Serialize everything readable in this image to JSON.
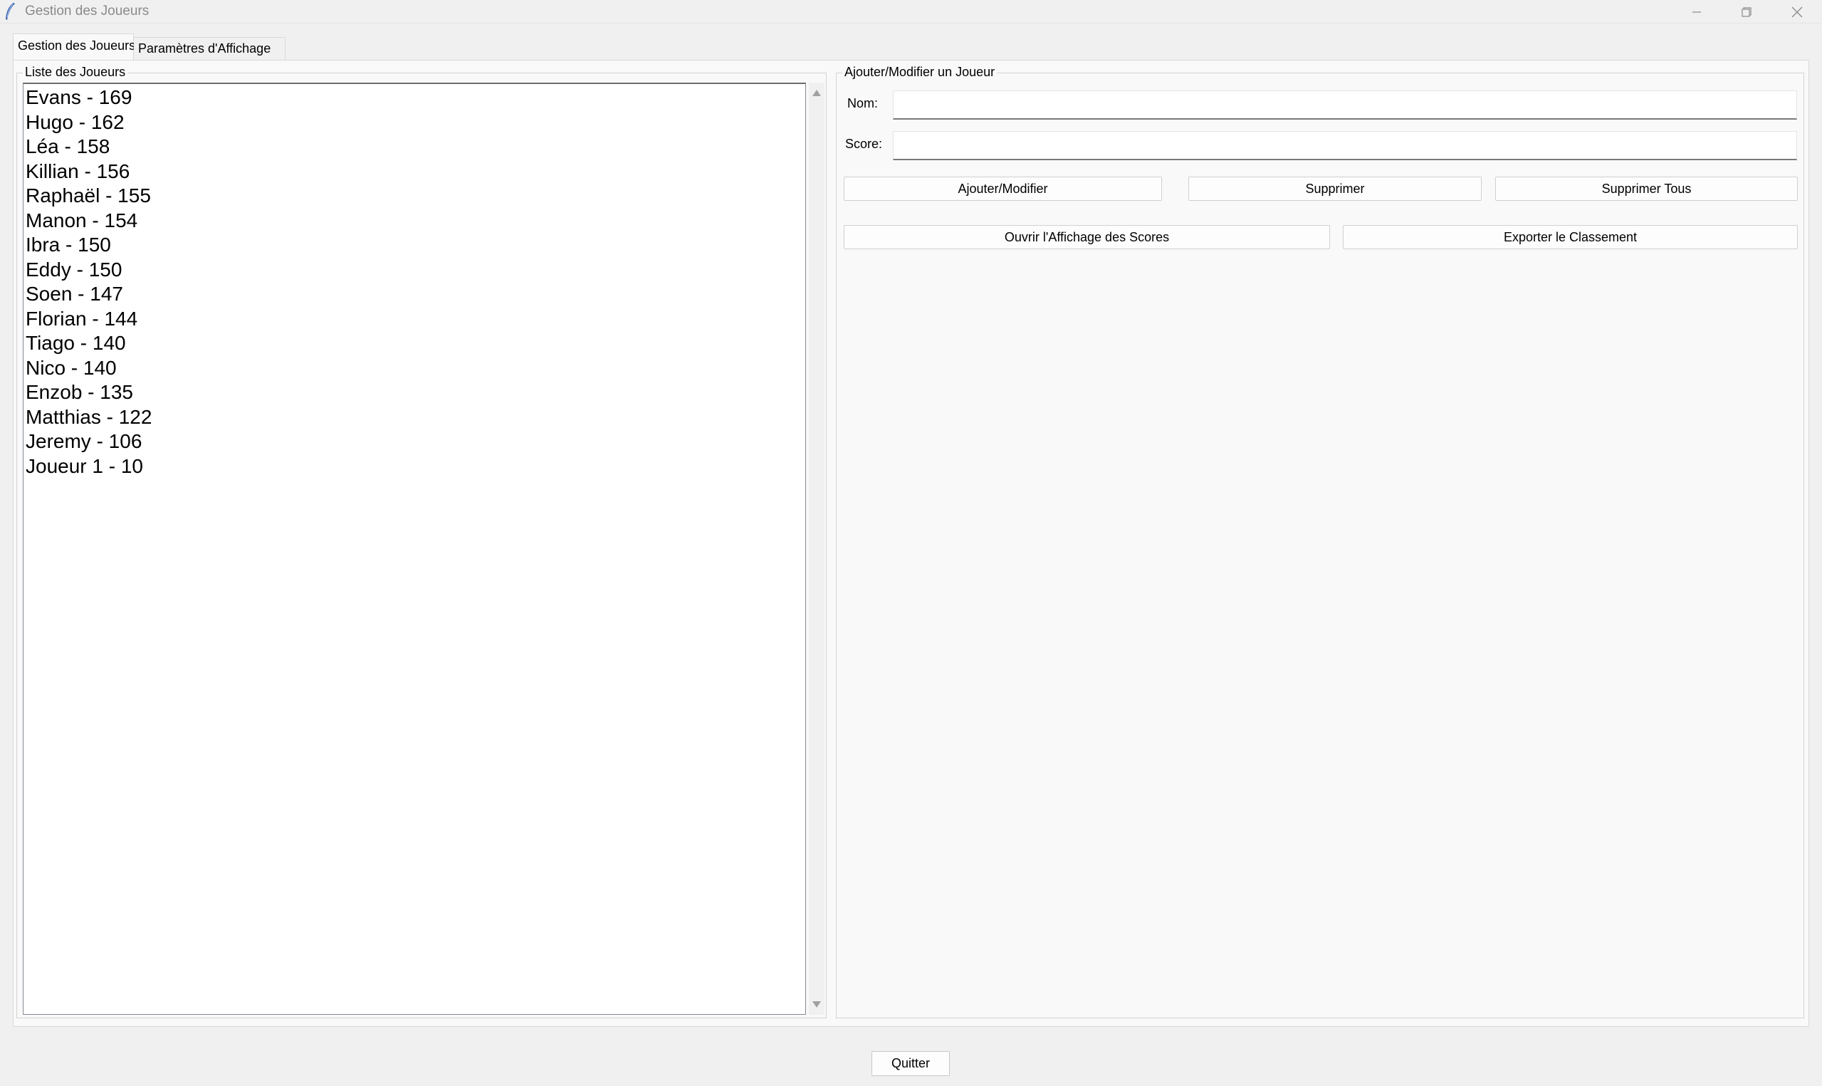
{
  "window": {
    "title": "Gestion des Joueurs",
    "controls": [
      "minimize-icon",
      "restore-icon",
      "close-icon"
    ]
  },
  "tabs": [
    {
      "label": "Gestion des Joueurs",
      "active": true
    },
    {
      "label": "Paramètres d'Affichage",
      "active": false
    }
  ],
  "player_list": {
    "frame_label": "Liste des Joueurs",
    "items": [
      "Evans - 169",
      "Hugo - 162",
      "Léa - 158",
      "Killian - 156",
      "Raphaël - 155",
      "Manon - 154",
      "Ibra - 150",
      "Eddy - 150",
      "Soen - 147",
      "Florian - 144",
      "Tiago - 140",
      "Nico - 140",
      "Enzob - 135",
      "Matthias - 122",
      "Jeremy - 106",
      "Joueur 1 - 10"
    ]
  },
  "form": {
    "frame_label": "Ajouter/Modifier un Joueur",
    "name_label": "Nom:",
    "name_value": "",
    "score_label": "Score:",
    "score_value": "",
    "buttons": {
      "add_modify": "Ajouter/Modifier",
      "delete": "Supprimer",
      "delete_all": "Supprimer Tous",
      "open_display": "Ouvrir l'Affichage des Scores",
      "export": "Exporter le Classement"
    }
  },
  "footer": {
    "quit_label": "Quitter"
  }
}
